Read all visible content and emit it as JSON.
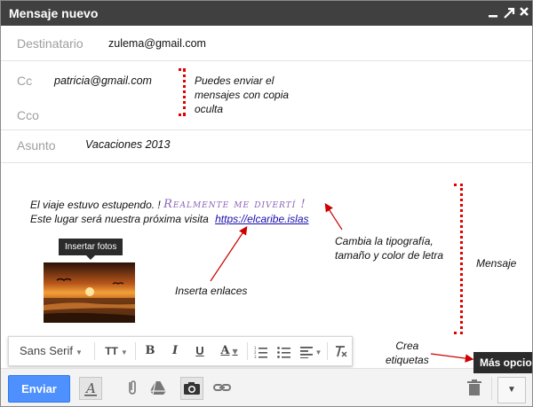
{
  "window": {
    "title": "Mensaje nuevo"
  },
  "fields": {
    "to": {
      "label": "Destinatario",
      "value": "zulema@gmail.com"
    },
    "cc": {
      "label": "Cc",
      "value": "patricia@gmail.com"
    },
    "bcc": {
      "label": "Cco"
    },
    "subject": {
      "label": "Asunto",
      "value": "Vacaciones 2013"
    }
  },
  "body": {
    "line1": "El viaje estuvo estupendo. !",
    "decorated": "Realmente me divertí !",
    "line2": "Este lugar será nuestra próxima visita",
    "link": "https://elcaribe.islas"
  },
  "annotations": {
    "cc_note": [
      "Puedes enviar el",
      "mensajes con copia",
      "oculta"
    ],
    "typography_note": [
      "Cambia la tipografía,",
      "tamaño y color de letra"
    ],
    "message_note": "Mensaje",
    "link_note": "Inserta enlaces",
    "labels_note": [
      "Crea",
      "etiquetas"
    ]
  },
  "tooltips": {
    "insert_photos": "Insertar fotos",
    "more_options": "Más opciones"
  },
  "formatting": {
    "font": "Sans Serif",
    "size_glyph": "TT",
    "bold": "B",
    "italic": "I",
    "underline": "U",
    "color": "A"
  },
  "toolbar": {
    "send": "Enviar"
  },
  "colors": {
    "send_button": "#4d90fe",
    "titlebar": "#404040",
    "annotation": "#e00000",
    "decorated_text": "#8a63b8"
  }
}
